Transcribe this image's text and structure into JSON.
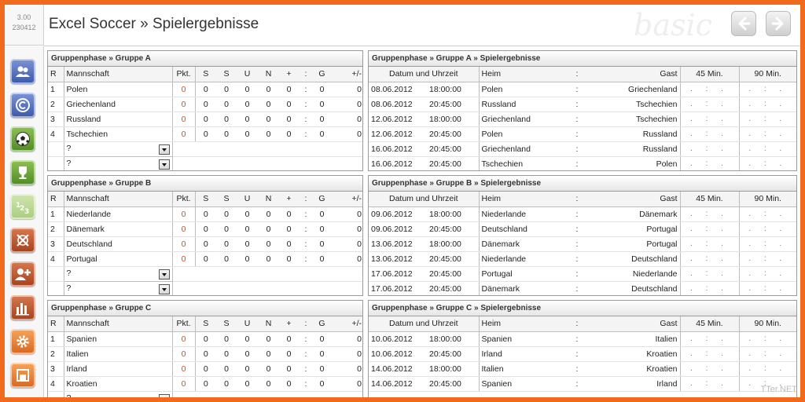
{
  "app": {
    "version": "3.00",
    "build": "230412",
    "title": "Excel Soccer » Spielergebnisse",
    "watermark": "basic",
    "credit": "TTer.NET"
  },
  "colors": {
    "frame": "#f26a1b",
    "points": "#c0561a"
  },
  "nav": {
    "back_icon": "arrow-left-icon",
    "forward_icon": "arrow-right-icon"
  },
  "sidebar": [
    {
      "name": "users-icon"
    },
    {
      "name": "copyright-icon"
    },
    {
      "name": "soccer-ball-icon"
    },
    {
      "name": "trophy-icon"
    },
    {
      "name": "numbers-icon"
    },
    {
      "name": "cancel-ball-icon"
    },
    {
      "name": "add-user-icon"
    },
    {
      "name": "bar-chart-icon"
    },
    {
      "name": "gear-icon"
    },
    {
      "name": "save-icon"
    }
  ],
  "standings_headers": [
    "R",
    "Mannschaft",
    "Pkt.",
    "S",
    "S",
    "U",
    "N",
    "+",
    ":",
    "G",
    "+/-"
  ],
  "results_headers": {
    "datetime": "Datum und Uhrzeit",
    "home": "Heim",
    "colon": ":",
    "away": "Gast",
    "half": "45 Min.",
    "full": "90 Min."
  },
  "select_placeholder": "?",
  "groups": [
    {
      "standings_title": "Gruppenphase  » Gruppe A",
      "results_title": "Gruppenphase  » Gruppe A » Spielergebnisse",
      "teams": [
        {
          "rank": "1",
          "name": "Polen",
          "pkt": "0",
          "s": "0",
          "s2": "0",
          "u": "0",
          "n": "0",
          "plus": "0",
          "colon": ":",
          "g": "0",
          "diff": "0"
        },
        {
          "rank": "2",
          "name": "Griechenland",
          "pkt": "0",
          "s": "0",
          "s2": "0",
          "u": "0",
          "n": "0",
          "plus": "0",
          "colon": ":",
          "g": "0",
          "diff": "0"
        },
        {
          "rank": "3",
          "name": "Russland",
          "pkt": "0",
          "s": "0",
          "s2": "0",
          "u": "0",
          "n": "0",
          "plus": "0",
          "colon": ":",
          "g": "0",
          "diff": "0"
        },
        {
          "rank": "4",
          "name": "Tschechien",
          "pkt": "0",
          "s": "0",
          "s2": "0",
          "u": "0",
          "n": "0",
          "plus": "0",
          "colon": ":",
          "g": "0",
          "diff": "0"
        }
      ],
      "matches": [
        {
          "date": "08.06.2012",
          "time": "18:00:00",
          "home": "Polen",
          "sep": ":",
          "away": "Griechenland",
          "half": ". : .",
          "full": ". : ."
        },
        {
          "date": "08.06.2012",
          "time": "20:45:00",
          "home": "Russland",
          "sep": ":",
          "away": "Tschechien",
          "half": ". : .",
          "full": ". : ."
        },
        {
          "date": "12.06.2012",
          "time": "18:00:00",
          "home": "Griechenland",
          "sep": ":",
          "away": "Tschechien",
          "half": ". : .",
          "full": ". : ."
        },
        {
          "date": "12.06.2012",
          "time": "20:45:00",
          "home": "Polen",
          "sep": ":",
          "away": "Russland",
          "half": ". : .",
          "full": ". : ."
        },
        {
          "date": "16.06.2012",
          "time": "20:45:00",
          "home": "Griechenland",
          "sep": ":",
          "away": "Russland",
          "half": ". : .",
          "full": ". : ."
        },
        {
          "date": "16.06.2012",
          "time": "20:45:00",
          "home": "Tschechien",
          "sep": ":",
          "away": "Polen",
          "half": ". : .",
          "full": ". : ."
        }
      ]
    },
    {
      "standings_title": "Gruppenphase  » Gruppe B",
      "results_title": "Gruppenphase  » Gruppe B » Spielergebnisse",
      "teams": [
        {
          "rank": "1",
          "name": "Niederlande",
          "pkt": "0",
          "s": "0",
          "s2": "0",
          "u": "0",
          "n": "0",
          "plus": "0",
          "colon": ":",
          "g": "0",
          "diff": "0"
        },
        {
          "rank": "2",
          "name": "Dänemark",
          "pkt": "0",
          "s": "0",
          "s2": "0",
          "u": "0",
          "n": "0",
          "plus": "0",
          "colon": ":",
          "g": "0",
          "diff": "0"
        },
        {
          "rank": "3",
          "name": "Deutschland",
          "pkt": "0",
          "s": "0",
          "s2": "0",
          "u": "0",
          "n": "0",
          "plus": "0",
          "colon": ":",
          "g": "0",
          "diff": "0"
        },
        {
          "rank": "4",
          "name": "Portugal",
          "pkt": "0",
          "s": "0",
          "s2": "0",
          "u": "0",
          "n": "0",
          "plus": "0",
          "colon": ":",
          "g": "0",
          "diff": "0"
        }
      ],
      "matches": [
        {
          "date": "09.06.2012",
          "time": "18:00:00",
          "home": "Niederlande",
          "sep": ":",
          "away": "Dänemark",
          "half": ". : .",
          "full": ". : ."
        },
        {
          "date": "09.06.2012",
          "time": "20:45:00",
          "home": "Deutschland",
          "sep": ":",
          "away": "Portugal",
          "half": ". : .",
          "full": ". : ."
        },
        {
          "date": "13.06.2012",
          "time": "18:00:00",
          "home": "Dänemark",
          "sep": ":",
          "away": "Portugal",
          "half": ". : .",
          "full": ". : ."
        },
        {
          "date": "13.06.2012",
          "time": "20:45:00",
          "home": "Niederlande",
          "sep": ":",
          "away": "Deutschland",
          "half": ". : .",
          "full": ". : ."
        },
        {
          "date": "17.06.2012",
          "time": "20:45:00",
          "home": "Portugal",
          "sep": ":",
          "away": "Niederlande",
          "half": ". : .",
          "full": ". : ."
        },
        {
          "date": "17.06.2012",
          "time": "20:45:00",
          "home": "Dänemark",
          "sep": ":",
          "away": "Deutschland",
          "half": ". : .",
          "full": ". : ."
        }
      ]
    },
    {
      "standings_title": "Gruppenphase  » Gruppe C",
      "results_title": "Gruppenphase  » Gruppe C » Spielergebnisse",
      "teams": [
        {
          "rank": "1",
          "name": "Spanien",
          "pkt": "0",
          "s": "0",
          "s2": "0",
          "u": "0",
          "n": "0",
          "plus": "0",
          "colon": ":",
          "g": "0",
          "diff": "0"
        },
        {
          "rank": "2",
          "name": "Italien",
          "pkt": "0",
          "s": "0",
          "s2": "0",
          "u": "0",
          "n": "0",
          "plus": "0",
          "colon": ":",
          "g": "0",
          "diff": "0"
        },
        {
          "rank": "3",
          "name": "Irland",
          "pkt": "0",
          "s": "0",
          "s2": "0",
          "u": "0",
          "n": "0",
          "plus": "0",
          "colon": ":",
          "g": "0",
          "diff": "0"
        },
        {
          "rank": "4",
          "name": "Kroatien",
          "pkt": "0",
          "s": "0",
          "s2": "0",
          "u": "0",
          "n": "0",
          "plus": "0",
          "colon": ":",
          "g": "0",
          "diff": "0"
        }
      ],
      "matches": [
        {
          "date": "10.06.2012",
          "time": "18:00:00",
          "home": "Spanien",
          "sep": ":",
          "away": "Italien",
          "half": ". : .",
          "full": ". : ."
        },
        {
          "date": "10.06.2012",
          "time": "20:45:00",
          "home": "Irland",
          "sep": ":",
          "away": "Kroatien",
          "half": ". : .",
          "full": ". : ."
        },
        {
          "date": "14.06.2012",
          "time": "18:00:00",
          "home": "Italien",
          "sep": ":",
          "away": "Kroatien",
          "half": ". : .",
          "full": ". : ."
        },
        {
          "date": "14.06.2012",
          "time": "20:45:00",
          "home": "Spanien",
          "sep": ":",
          "away": "Irland",
          "half": ". : .",
          "full": ". : ."
        }
      ]
    }
  ]
}
